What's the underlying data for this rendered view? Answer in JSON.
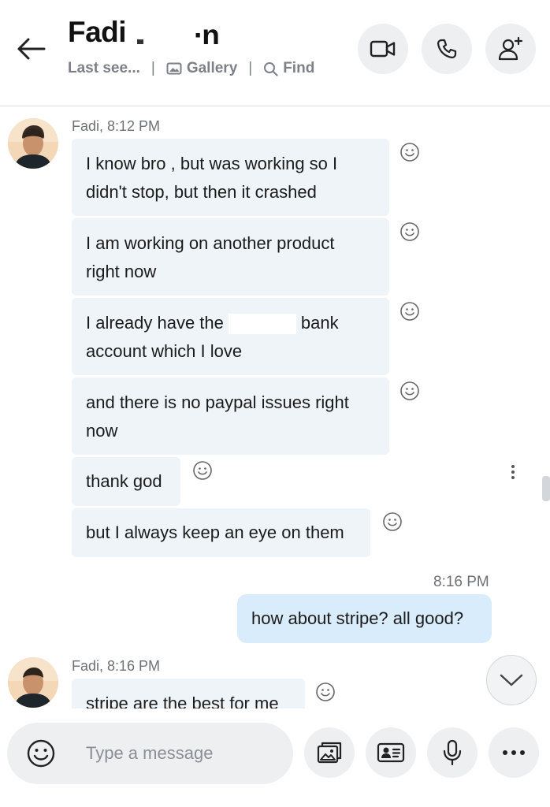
{
  "header": {
    "contact_name": "Fadi",
    "name_tail_visible": "∙n",
    "status": "Last see...",
    "gallery_label": "Gallery",
    "find_label": "Find",
    "icons": {
      "back": "arrow-left-icon",
      "video": "video-camera-icon",
      "call": "phone-icon",
      "add_person": "add-person-icon"
    }
  },
  "messages": {
    "group1": {
      "sender_time": "Fadi, 8:12 PM",
      "m1_line1": "I know bro , but was working so I",
      "m1_line2": "didn't stop, but then it crashed",
      "m2_line1": "I am working on another product",
      "m2_line2": "right now",
      "m3_part1": "I already have the",
      "m3_part2": "bank",
      "m3_line2": "account which I love",
      "m4_line1": "and there is no paypal issues right",
      "m4_line2": "now",
      "m5": "thank god",
      "m6": "but I always keep an eye on them"
    },
    "outgoing": {
      "time": "8:16 PM",
      "text": "how about stripe? all good?"
    },
    "group2": {
      "sender_time": "Fadi, 8:16 PM",
      "m1": "stripe are the best for me"
    }
  },
  "composer": {
    "placeholder": "Type a message",
    "icons": {
      "emoji": "smiley-icon",
      "media": "gallery-icon",
      "contact": "contact-card-icon",
      "mic": "microphone-icon",
      "more": "more-icon"
    }
  },
  "colors": {
    "incoming_bubble": "#eef4f8",
    "outgoing_bubble": "#d8ecfb",
    "button_bg": "#eeeff1",
    "muted_text": "#6c7177"
  }
}
